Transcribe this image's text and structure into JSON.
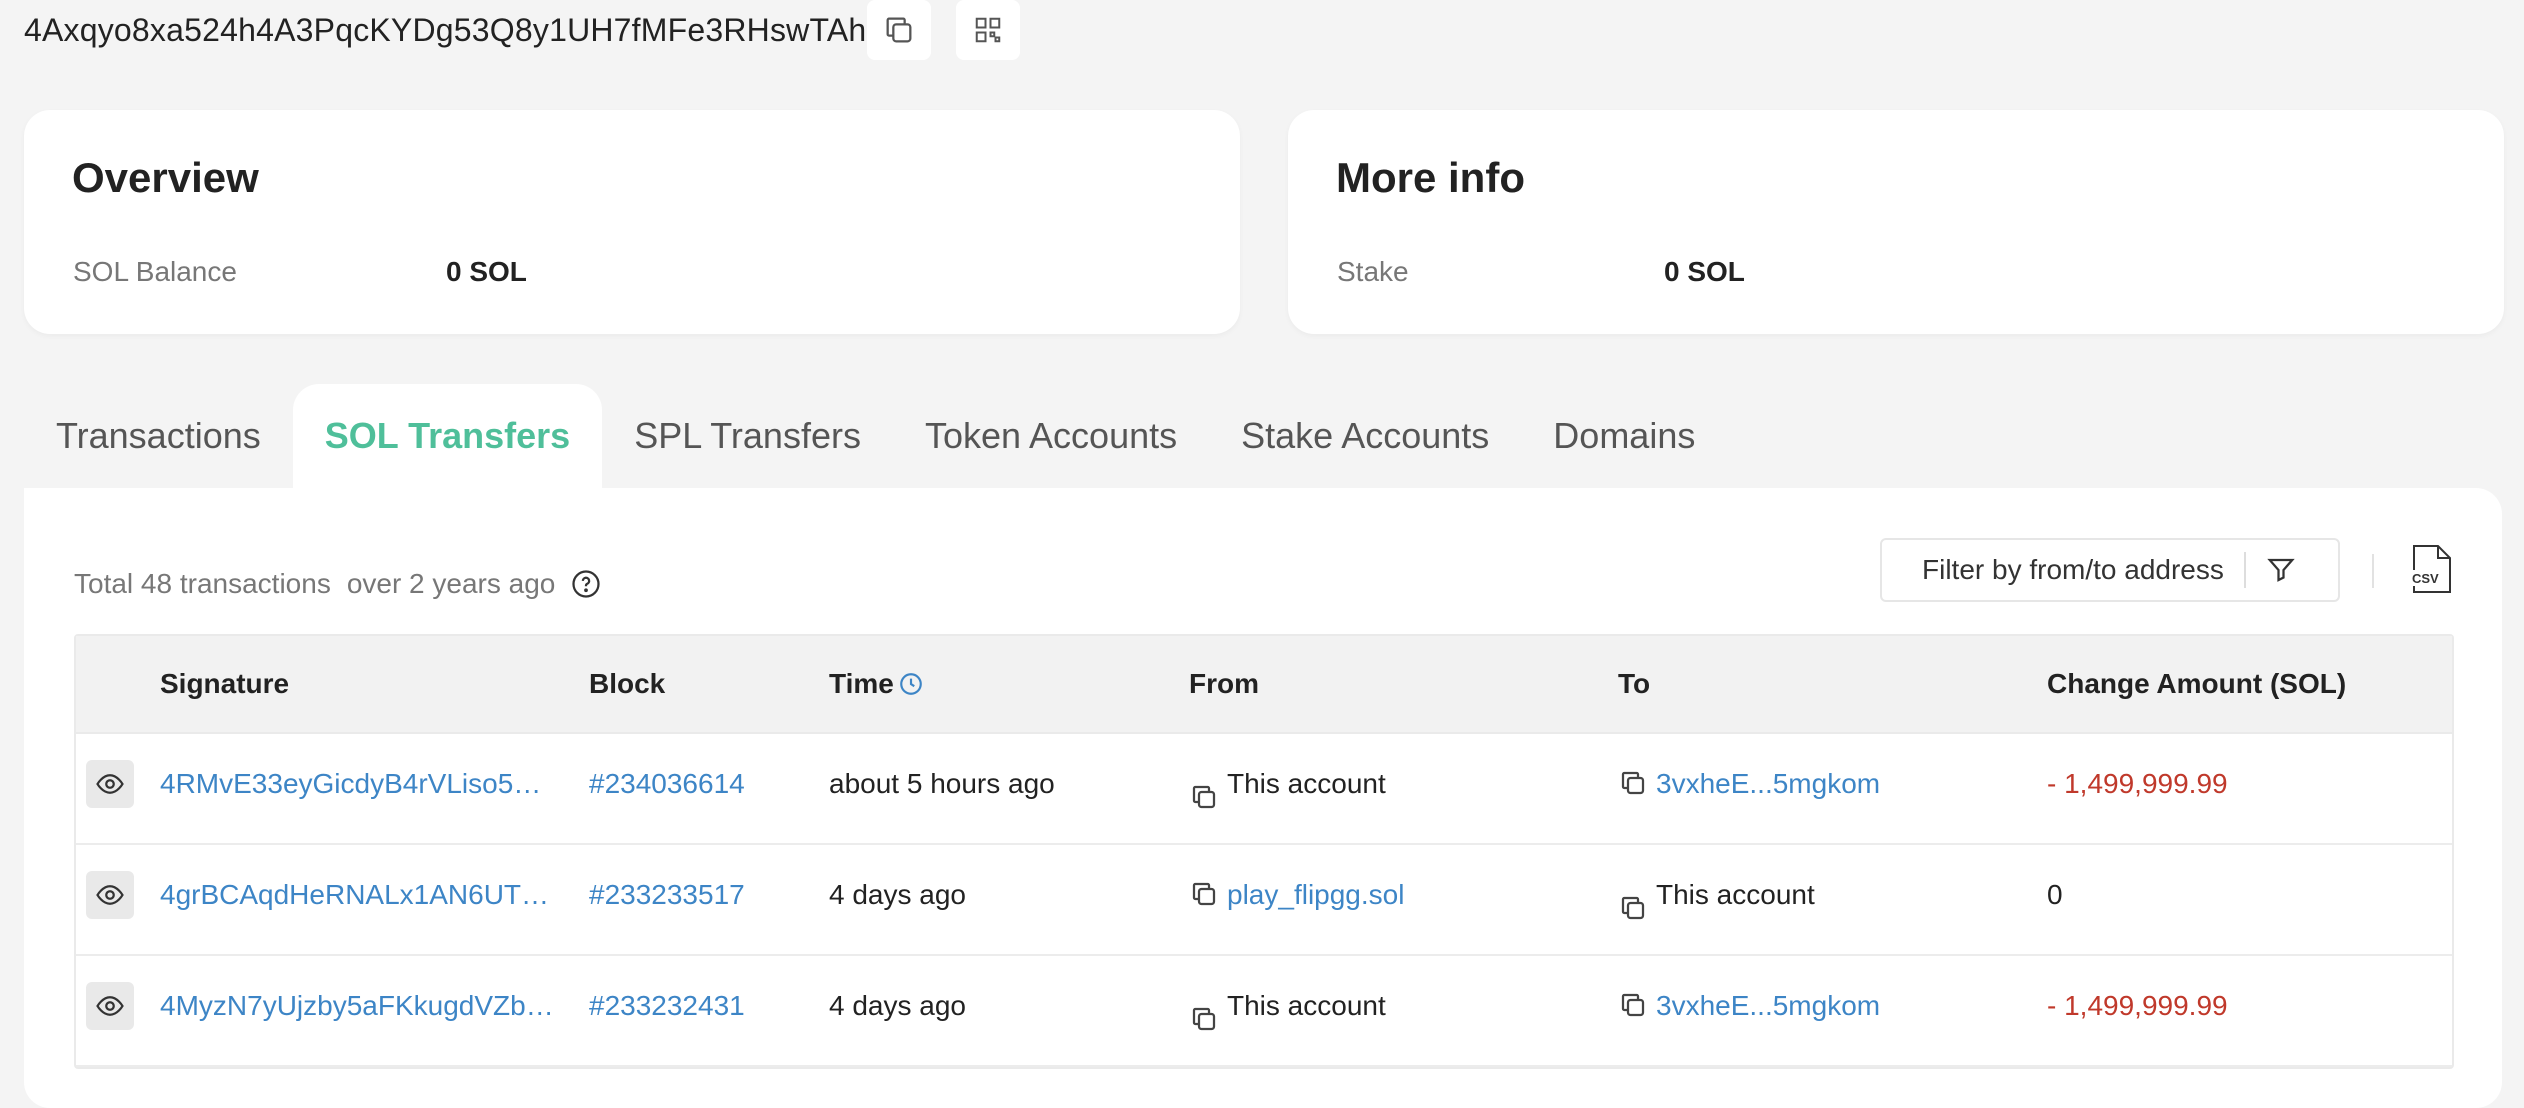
{
  "header": {
    "address": "4Axqyo8xa524h4A3PqcKYDg53Q8y1UH7fMFe3RHswTAh",
    "copy_icon": "copy-icon",
    "qr_icon": "qr-code-icon"
  },
  "overview": {
    "title": "Overview",
    "label": "SOL Balance",
    "value": "0 SOL"
  },
  "more_info": {
    "title": "More info",
    "label": "Stake",
    "value": "0 SOL"
  },
  "tabs": [
    {
      "label": "Transactions"
    },
    {
      "label": "SOL Transfers",
      "active": true
    },
    {
      "label": "SPL Transfers"
    },
    {
      "label": "Token Accounts"
    },
    {
      "label": "Stake Accounts"
    },
    {
      "label": "Domains"
    }
  ],
  "summary": {
    "total": "Total 48 transactions",
    "age": "over 2 years ago"
  },
  "filter": {
    "label": "Filter by from/to address"
  },
  "csv_label": "CSV",
  "table": {
    "columns": [
      "Signature",
      "Block",
      "Time",
      "From",
      "To",
      "Change Amount (SOL)"
    ],
    "rows": [
      {
        "signature": "4RMvE33eyGicdyB4rVLiso5…",
        "block": "#234036614",
        "time": "about 5 hours ago",
        "from": "This account",
        "to": "3vxheE...5mgkom",
        "amount": "- 1,499,999.99"
      },
      {
        "signature": "4grBCAqdHeRNALx1AN6UT…",
        "block": "#233233517",
        "time": "4 days ago",
        "from": "play_flipgg.sol",
        "to": "This account",
        "amount": "0"
      },
      {
        "signature": "4MyzN7yUjzby5aFKkugdVZb…",
        "block": "#233232431",
        "time": "4 days ago",
        "from": "This account",
        "to": "3vxheE...5mgkom",
        "amount": "- 1,499,999.99"
      }
    ]
  },
  "colors": {
    "accent": "#4fbf9a",
    "link": "#3d85c6",
    "negative": "#c0392b",
    "background": "#f4f4f4"
  }
}
